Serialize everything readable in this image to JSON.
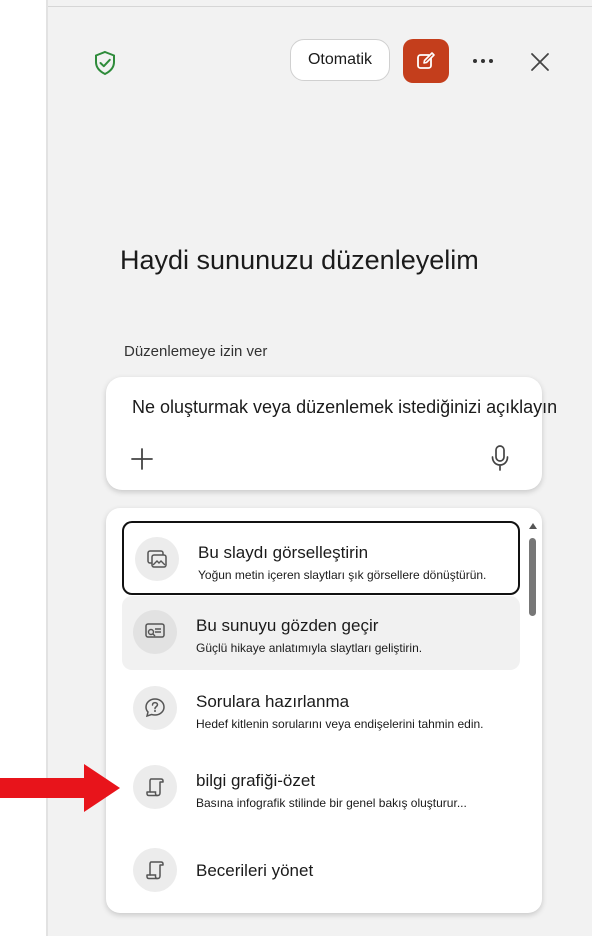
{
  "header": {
    "auto_label": "Otomatik"
  },
  "main": {
    "heading": "Haydi sununuzu düzenleyelim",
    "permission_label": "Düzenlemeye izin ver",
    "prompt_text": "Ne oluşturmak veya düzenlemek istediğinizi açıklayın"
  },
  "menu": {
    "items": [
      {
        "title": "Bu slaydı görselleştirin",
        "desc": "Yoğun metin içeren slaytları şık görsellere dönüştürün.",
        "icon": "image-slide-icon",
        "state": "selected"
      },
      {
        "title": "Bu sunuyu gözden geçir",
        "desc": "Güçlü hikaye anlatımıyla slaytları geliştirin.",
        "icon": "review-slide-icon",
        "state": "hover"
      },
      {
        "title": "Sorulara hazırlanma",
        "desc": "Hedef kitlenin sorularını veya endişelerini tahmin edin.",
        "icon": "question-chat-icon",
        "state": "normal"
      },
      {
        "title": "bilgi grafiği-özet",
        "desc": "Basına infografik stilinde bir genel bakış oluşturur...",
        "icon": "scroll-icon",
        "state": "normal"
      },
      {
        "title": "Becerileri yönet",
        "desc": "",
        "icon": "scroll-icon",
        "state": "normal"
      }
    ]
  },
  "colors": {
    "accent": "#c43e1c",
    "shield": "#2e8b3a",
    "arrow": "#e8141b"
  }
}
